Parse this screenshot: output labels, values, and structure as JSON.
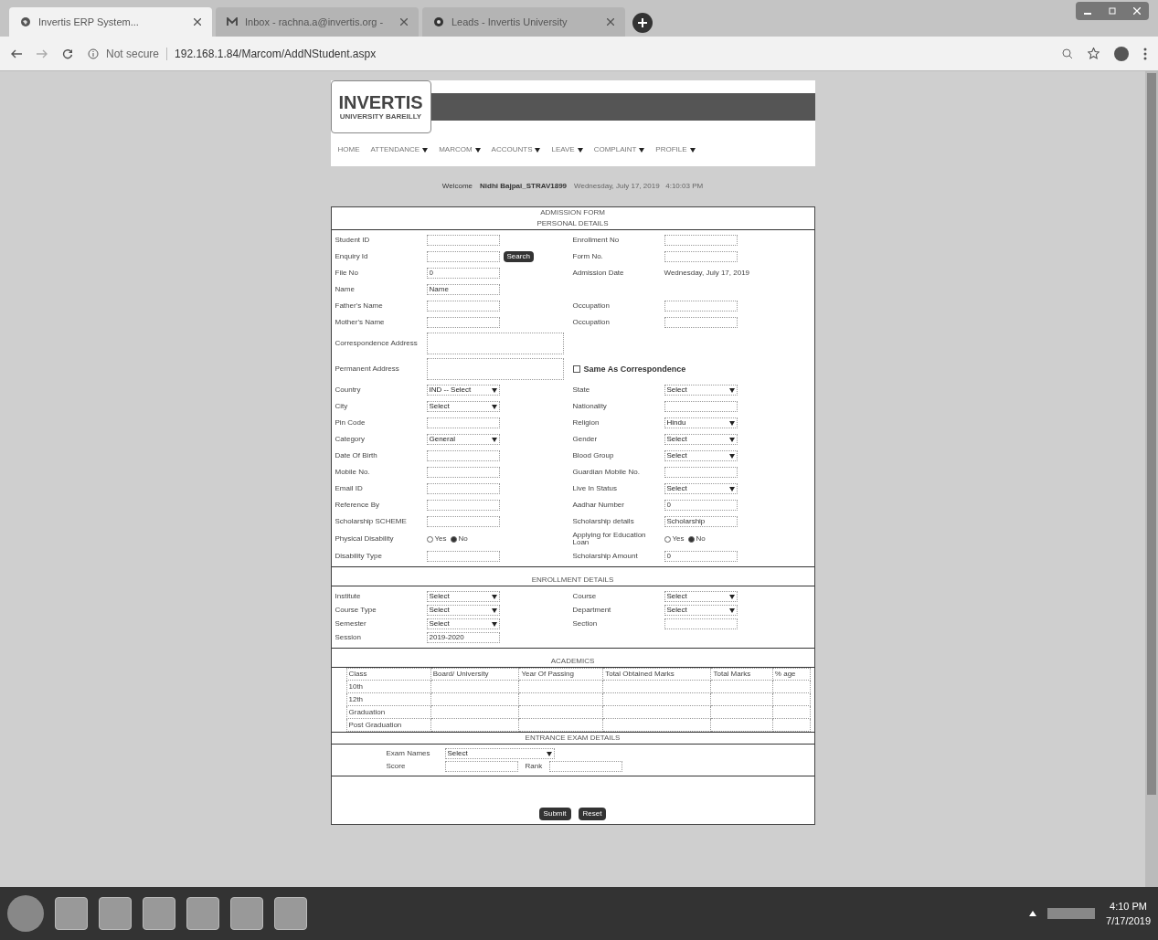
{
  "browser": {
    "tabs": [
      {
        "title": "Invertis ERP System...",
        "selected": true,
        "kind": "globe"
      },
      {
        "title": "Inbox - rachna.a@invertis.org -",
        "selected": false,
        "kind": "mail"
      },
      {
        "title": "Leads - Invertis University",
        "selected": false,
        "kind": "leads"
      }
    ],
    "security": "Not secure",
    "url": "192.168.1.84/Marcom/AddNStudent.aspx"
  },
  "header": {
    "logo": "INVERTIS",
    "logo_sub": "UNIVERSITY BAREILLY",
    "menu": [
      {
        "label": "HOME",
        "dropdown": false
      },
      {
        "label": "ATTENDANCE",
        "dropdown": true
      },
      {
        "label": "MARCOM",
        "dropdown": true
      },
      {
        "label": "ACCOUNTS",
        "dropdown": true
      },
      {
        "label": "LEAVE",
        "dropdown": true
      },
      {
        "label": "COMPLAINT",
        "dropdown": true
      },
      {
        "label": "PROFILE",
        "dropdown": true
      }
    ]
  },
  "welcome": {
    "label": "Welcome",
    "user": "Nidhi Bajpai_STRAV1899",
    "datetime": "Wednesday, July 17, 2019   4:10:03 PM"
  },
  "form": {
    "title": "ADMISSION FORM",
    "personal_title": "PERSONAL DETAILS",
    "personal": [
      {
        "left": {
          "label": "Student ID",
          "kind": "input"
        },
        "right": {
          "label": "Enrollment No",
          "kind": "input"
        }
      },
      {
        "left": {
          "label": "Enquiry Id",
          "kind": "input",
          "button": "Search"
        },
        "right": {
          "label": "Form No.",
          "kind": "input"
        }
      },
      {
        "left": {
          "label": "File No",
          "kind": "input",
          "value": "0"
        },
        "right": {
          "label": "Admission Date",
          "kind": "text",
          "value": "Wednesday, July 17, 2019"
        }
      },
      {
        "left": {
          "label": "Name",
          "kind": "input",
          "value": "Name"
        }
      },
      {
        "left": {
          "label": "Father's Name",
          "kind": "input"
        },
        "right": {
          "label": "Occupation",
          "kind": "input"
        }
      },
      {
        "left": {
          "label": "Mother's Name",
          "kind": "input"
        },
        "right": {
          "label": "Occupation",
          "kind": "input"
        }
      },
      {
        "left": {
          "label": "Correspondence Address",
          "kind": "textarea"
        }
      },
      {
        "left": {
          "label": "Permanent Address",
          "kind": "textarea"
        },
        "right": {
          "label": "Same As Correspondence",
          "kind": "check",
          "checked": false
        }
      },
      {
        "left": {
          "label": "Country",
          "kind": "select",
          "value": "IND -- Select"
        },
        "right": {
          "label": "State",
          "kind": "select",
          "value": "Select"
        }
      },
      {
        "left": {
          "label": "City",
          "kind": "select",
          "value": "Select"
        },
        "right": {
          "label": "Nationality",
          "kind": "input"
        }
      },
      {
        "left": {
          "label": "Pin Code",
          "kind": "input"
        },
        "right": {
          "label": "Religion",
          "kind": "select",
          "value": "Hindu"
        }
      },
      {
        "left": {
          "label": "Category",
          "kind": "select",
          "value": "General"
        },
        "right": {
          "label": "Gender",
          "kind": "select",
          "value": "Select"
        }
      },
      {
        "left": {
          "label": "Date Of Birth",
          "kind": "input"
        },
        "right": {
          "label": "Blood Group",
          "kind": "select",
          "value": "Select"
        }
      },
      {
        "left": {
          "label": "Mobile No.",
          "kind": "input"
        },
        "right": {
          "label": "Guardian Mobile No.",
          "kind": "input"
        }
      },
      {
        "left": {
          "label": "Email ID",
          "kind": "input"
        },
        "right": {
          "label": "Live In Status",
          "kind": "select",
          "value": "Select"
        }
      },
      {
        "left": {
          "label": "Reference By",
          "kind": "input"
        },
        "right": {
          "label": "Aadhar Number",
          "kind": "input",
          "value": "0"
        }
      },
      {
        "left": {
          "label": "Scholarship SCHEME",
          "kind": "input"
        },
        "right": {
          "label": "Scholarship details",
          "kind": "input",
          "value": "Scholarship"
        }
      },
      {
        "left": {
          "label": "Physical Disability",
          "kind": "radio",
          "options": [
            {
              "label": "Yes",
              "selected": false
            },
            {
              "label": "No",
              "selected": true
            }
          ]
        },
        "right": {
          "label": "Applying for Education Loan",
          "kind": "radio",
          "options": [
            {
              "label": "Yes",
              "selected": false
            },
            {
              "label": "No",
              "selected": true
            }
          ]
        }
      },
      {
        "left": {
          "label": "Disability Type",
          "kind": "input"
        },
        "right": {
          "label": "Scholarship Amount",
          "kind": "input",
          "value": "0"
        }
      }
    ],
    "enrollment_title": "ENROLLMENT DETAILS",
    "enrollment": [
      {
        "left": {
          "label": "Institute",
          "kind": "select",
          "value": "Select"
        },
        "right": {
          "label": "Course",
          "kind": "select",
          "value": "Select"
        }
      },
      {
        "left": {
          "label": "Course Type",
          "kind": "select",
          "value": "Select"
        },
        "right": {
          "label": "Department",
          "kind": "select",
          "value": "Select"
        }
      },
      {
        "left": {
          "label": "Semester",
          "kind": "select",
          "value": "Select"
        },
        "right": {
          "label": "Section",
          "kind": "input"
        }
      },
      {
        "left": {
          "label": "Session",
          "kind": "input",
          "value": "2019-2020"
        }
      }
    ],
    "academics_title": "ACADEMICS",
    "academics": {
      "columns": [
        "Class",
        "Board/ University",
        "Year Of Passing",
        "Total Obtained Marks",
        "Total Marks",
        "% age"
      ],
      "rows": [
        "10th",
        "12th",
        "Graduation",
        "Post Graduation"
      ]
    },
    "entrance_title": "ENTRANCE EXAM DETAILS",
    "entrance": {
      "exam_label": "Exam Names",
      "exam_value": "Select",
      "score_label": "Score",
      "rank_label": "Rank"
    },
    "buttons": [
      "Submit",
      "Reset"
    ]
  },
  "taskbar": {
    "time": "4:10 PM",
    "date": "7/17/2019"
  }
}
